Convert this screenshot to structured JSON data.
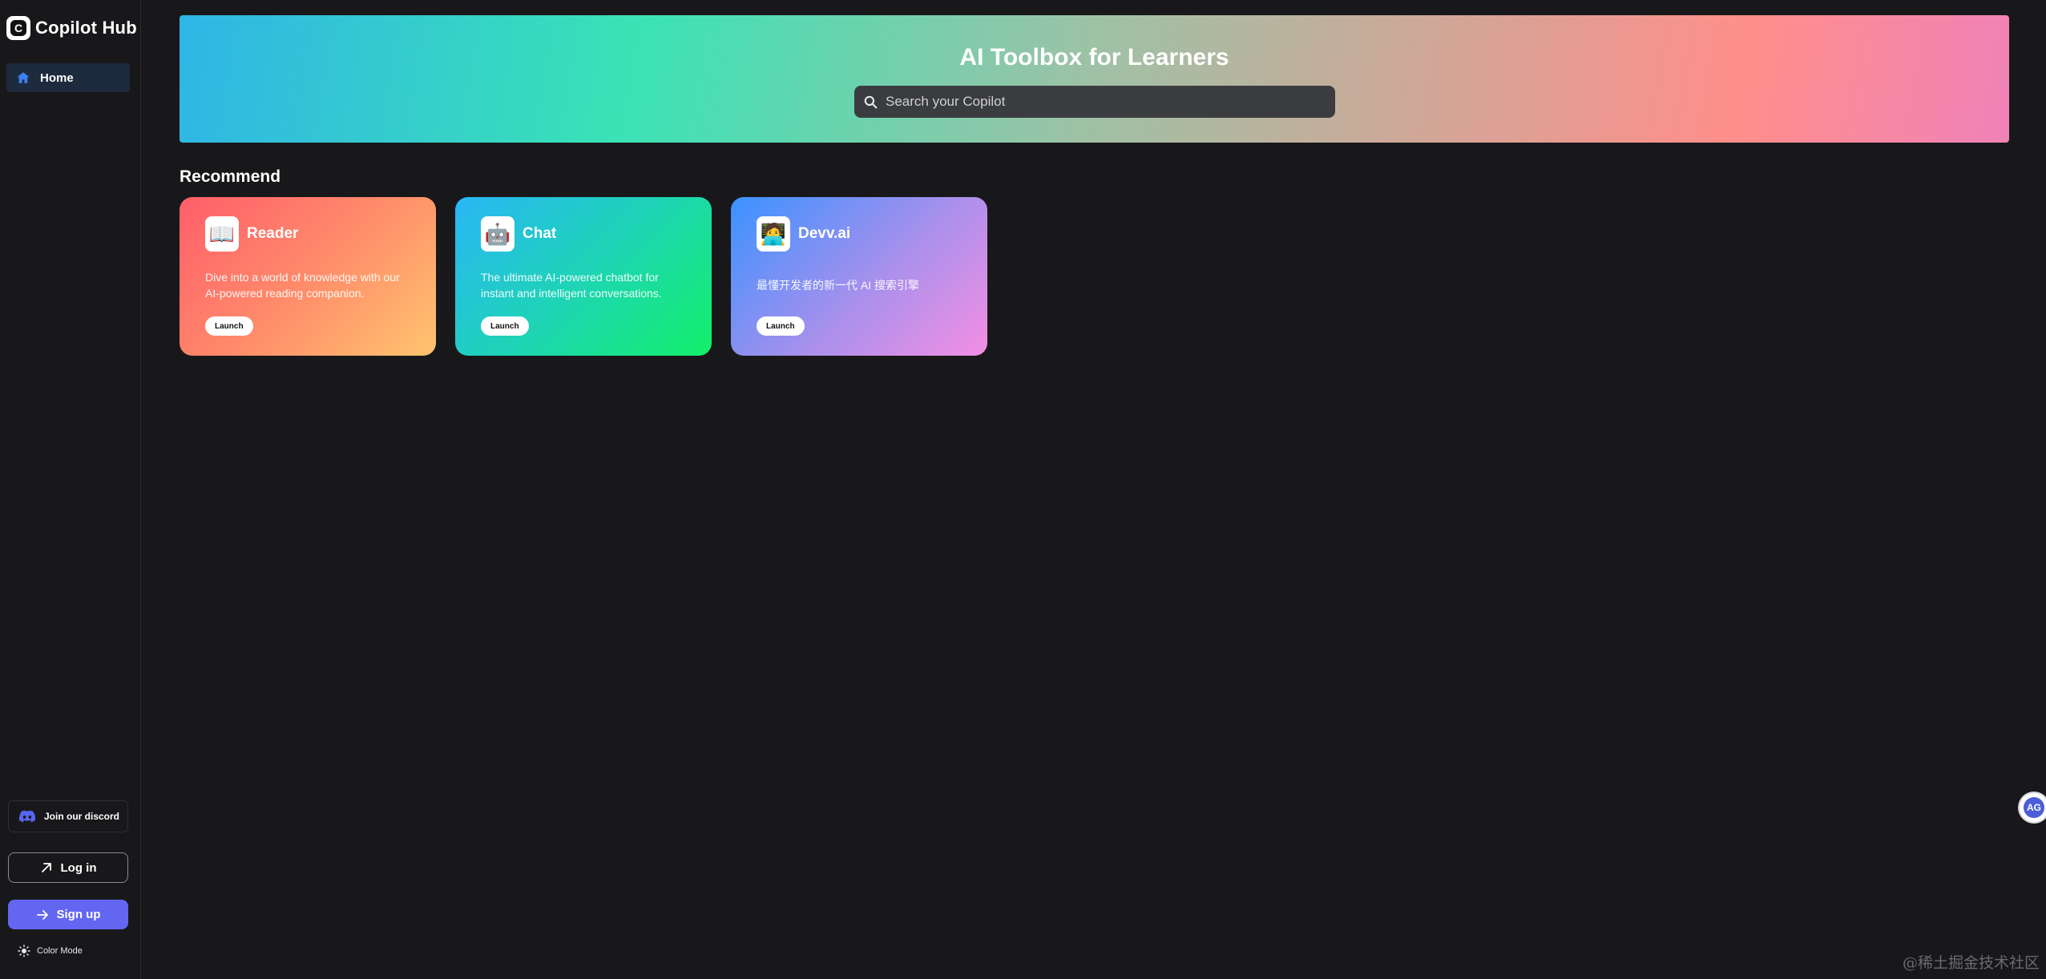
{
  "brand": {
    "name": "Copilot Hub",
    "logo_letter": "C"
  },
  "sidebar": {
    "nav": [
      {
        "label": "Home",
        "icon": "home-icon"
      }
    ],
    "discord_label": "Join our discord",
    "login_label": "Log in",
    "signup_label": "Sign up",
    "color_mode_label": "Color Mode"
  },
  "hero": {
    "title": "AI Toolbox for Learners",
    "search_placeholder": "Search your Copilot"
  },
  "recommend": {
    "title": "Recommend",
    "cards": [
      {
        "name": "Reader",
        "icon": "📖",
        "description": "Dive into a world of knowledge with our AI-powered reading companion.",
        "button": "Launch"
      },
      {
        "name": "Chat",
        "icon": "🤖",
        "description": "The ultimate AI-powered chatbot for instant and intelligent conversations.",
        "button": "Launch"
      },
      {
        "name": "Devv.ai",
        "icon": "🧑‍💻",
        "description": "最懂开发者的新一代 AI 搜索引擎",
        "button": "Launch"
      }
    ]
  },
  "widget": {
    "label": "AG"
  },
  "watermark": "@稀土掘金技术社区",
  "colors": {
    "background": "#18181b",
    "accent": "#6366f1",
    "nav_active": "#1e2a3d",
    "home_icon": "#3b82f6",
    "discord": "#5865f2"
  }
}
